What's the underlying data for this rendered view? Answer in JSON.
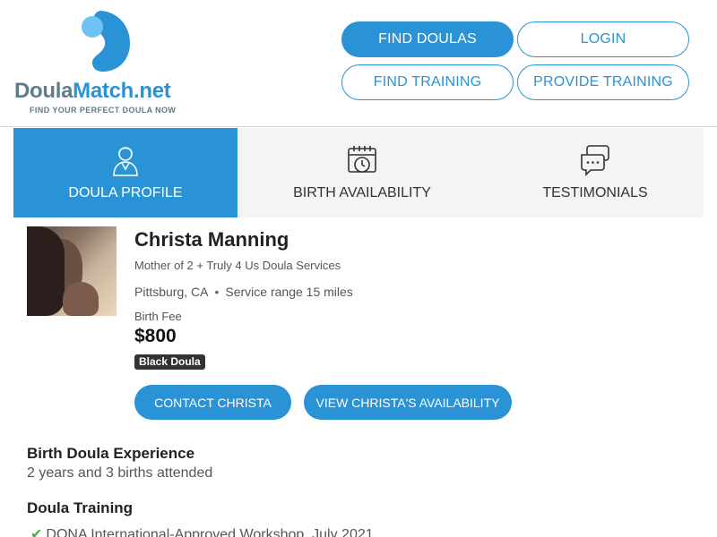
{
  "brand": {
    "logo_part1": "Doula",
    "logo_part2": "Match.net",
    "tagline": "FIND YOUR PERFECT DOULA NOW",
    "primary_color": "#2a93d5",
    "secondary_color": "#5f7c8a"
  },
  "nav": {
    "find_doulas": "FIND DOULAS",
    "login": "LOGIN",
    "find_training": "FIND TRAINING",
    "provide_training": "PROVIDE TRAINING"
  },
  "tabs": [
    {
      "label": "DOULA PROFILE",
      "icon": "person-icon",
      "active": true
    },
    {
      "label": "BIRTH AVAILABILITY",
      "icon": "calendar-clock-icon",
      "active": false
    },
    {
      "label": "TESTIMONIALS",
      "icon": "chat-bubbles-icon",
      "active": false
    }
  ],
  "profile": {
    "name": "Christa Manning",
    "agency": "Mother of 2 + Truly 4 Us Doula Services",
    "city": "Pittsburg, CA",
    "service_range": "Service range 15 miles",
    "fee_label": "Birth Fee",
    "fee_value": "$800",
    "badge": "Black Doula",
    "contact_button": "CONTACT CHRISTA",
    "availability_button": "VIEW CHRISTA'S AVAILABILITY"
  },
  "experience": {
    "title": "Birth Doula Experience",
    "text": "2 years and 3 births attended"
  },
  "training": {
    "title": "Doula Training",
    "items": [
      "DONA International-Approved Workshop, July 2021"
    ]
  }
}
